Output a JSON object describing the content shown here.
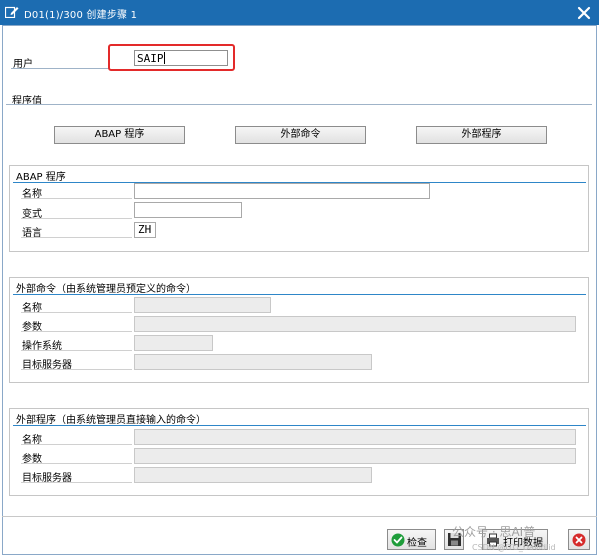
{
  "window": {
    "title": "D01(1)/300 创建步骤  1"
  },
  "user": {
    "label": "用户",
    "value": "SAIP"
  },
  "program_values": {
    "header": "程序值",
    "buttons": [
      "ABAP 程序",
      "外部命令",
      "外部程序"
    ]
  },
  "abap_group": {
    "title": "ABAP 程序",
    "rows": [
      {
        "label": "名称",
        "value": ""
      },
      {
        "label": "变式",
        "value": ""
      },
      {
        "label": "语言",
        "value": "ZH"
      }
    ]
  },
  "ext_command_group": {
    "title": "外部命令（由系统管理员预定义的命令）",
    "rows": [
      {
        "label": "名称",
        "value": ""
      },
      {
        "label": "参数",
        "value": ""
      },
      {
        "label": "操作系统",
        "value": ""
      },
      {
        "label": "目标服务器",
        "value": ""
      }
    ]
  },
  "ext_program_group": {
    "title": "外部程序（由系统管理员直接输入的命令）",
    "rows": [
      {
        "label": "名称",
        "value": ""
      },
      {
        "label": "参数",
        "value": ""
      },
      {
        "label": "目标服务器",
        "value": ""
      }
    ]
  },
  "footer": {
    "check_label": "检查",
    "print_label": "打印数据",
    "icons": [
      "check-icon",
      "save-icon",
      "printer-icon",
      "cancel-icon"
    ]
  },
  "watermark": {
    "text": "公众号 · 思AI普",
    "small_text": "CSDN @ITO_Davidlid"
  },
  "colors": {
    "titlebar": "#1c6cb1",
    "highlight": "#e32a2a",
    "group_rule": "#2e86c8",
    "check_green": "#1e9d3a",
    "cancel_red": "#d62b2b"
  }
}
